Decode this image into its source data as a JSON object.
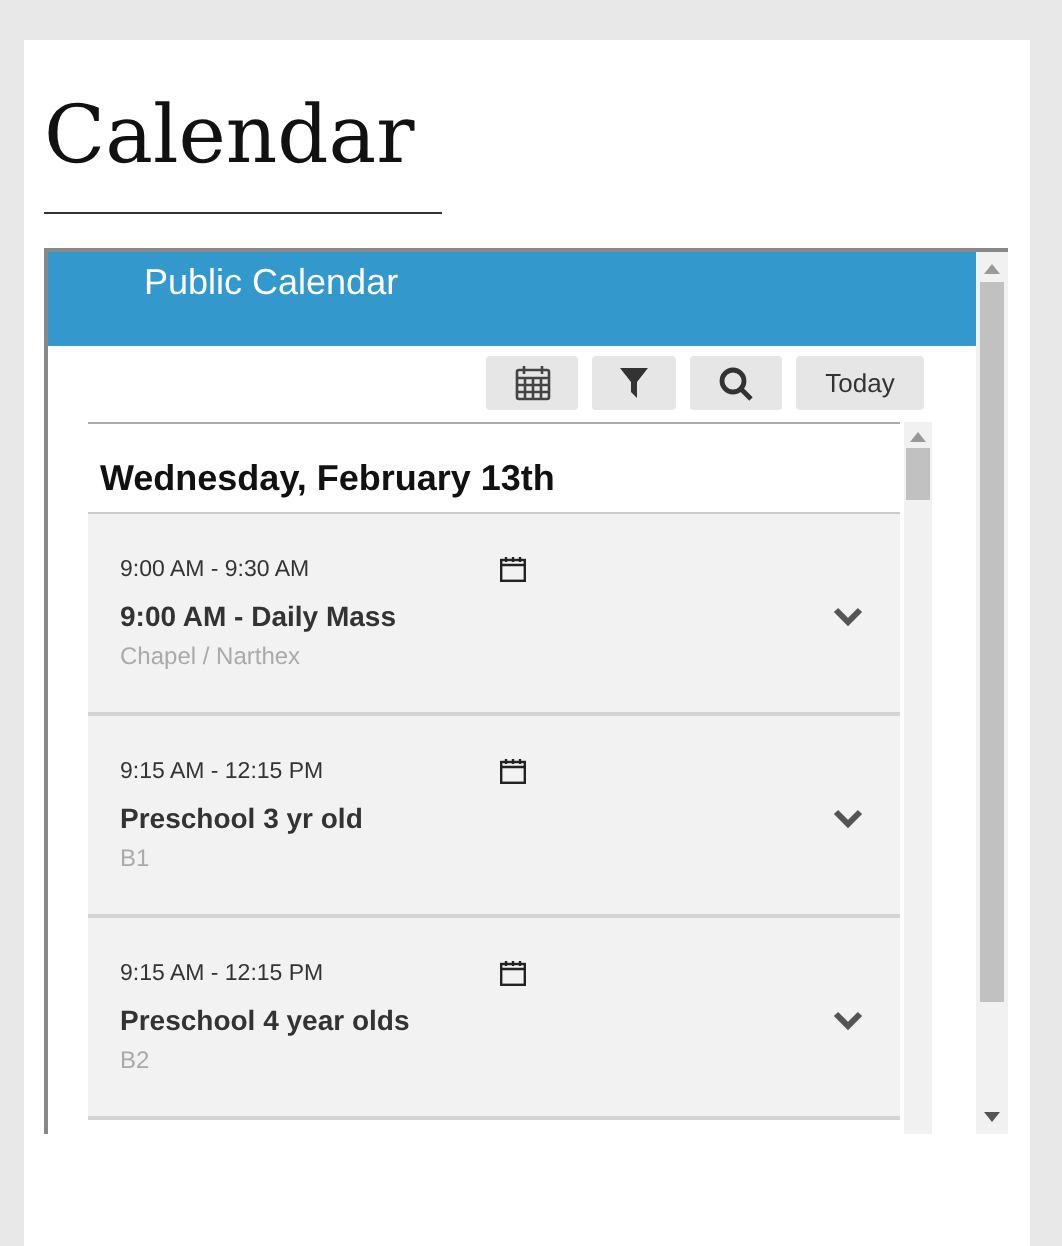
{
  "page": {
    "title": "Calendar"
  },
  "widget": {
    "title": "Public Calendar",
    "toolbar": [
      {
        "kind": "calendar"
      },
      {
        "kind": "filter"
      },
      {
        "kind": "search"
      },
      {
        "kind": "text",
        "label": "Today"
      }
    ],
    "day": "Wednesday, February 13th",
    "events": [
      {
        "time": "9:00 AM - 9:30 AM",
        "title": "9:00 AM - Daily Mass",
        "location": "Chapel / Narthex",
        "expanded": false
      },
      {
        "time": "9:15 AM - 12:15 PM",
        "title": "Preschool 3 yr old",
        "location": "B1",
        "expanded": false
      },
      {
        "time": "9:15 AM - 12:15 PM",
        "title": "Preschool 4 year olds",
        "location": "B2",
        "expanded": false
      }
    ]
  }
}
